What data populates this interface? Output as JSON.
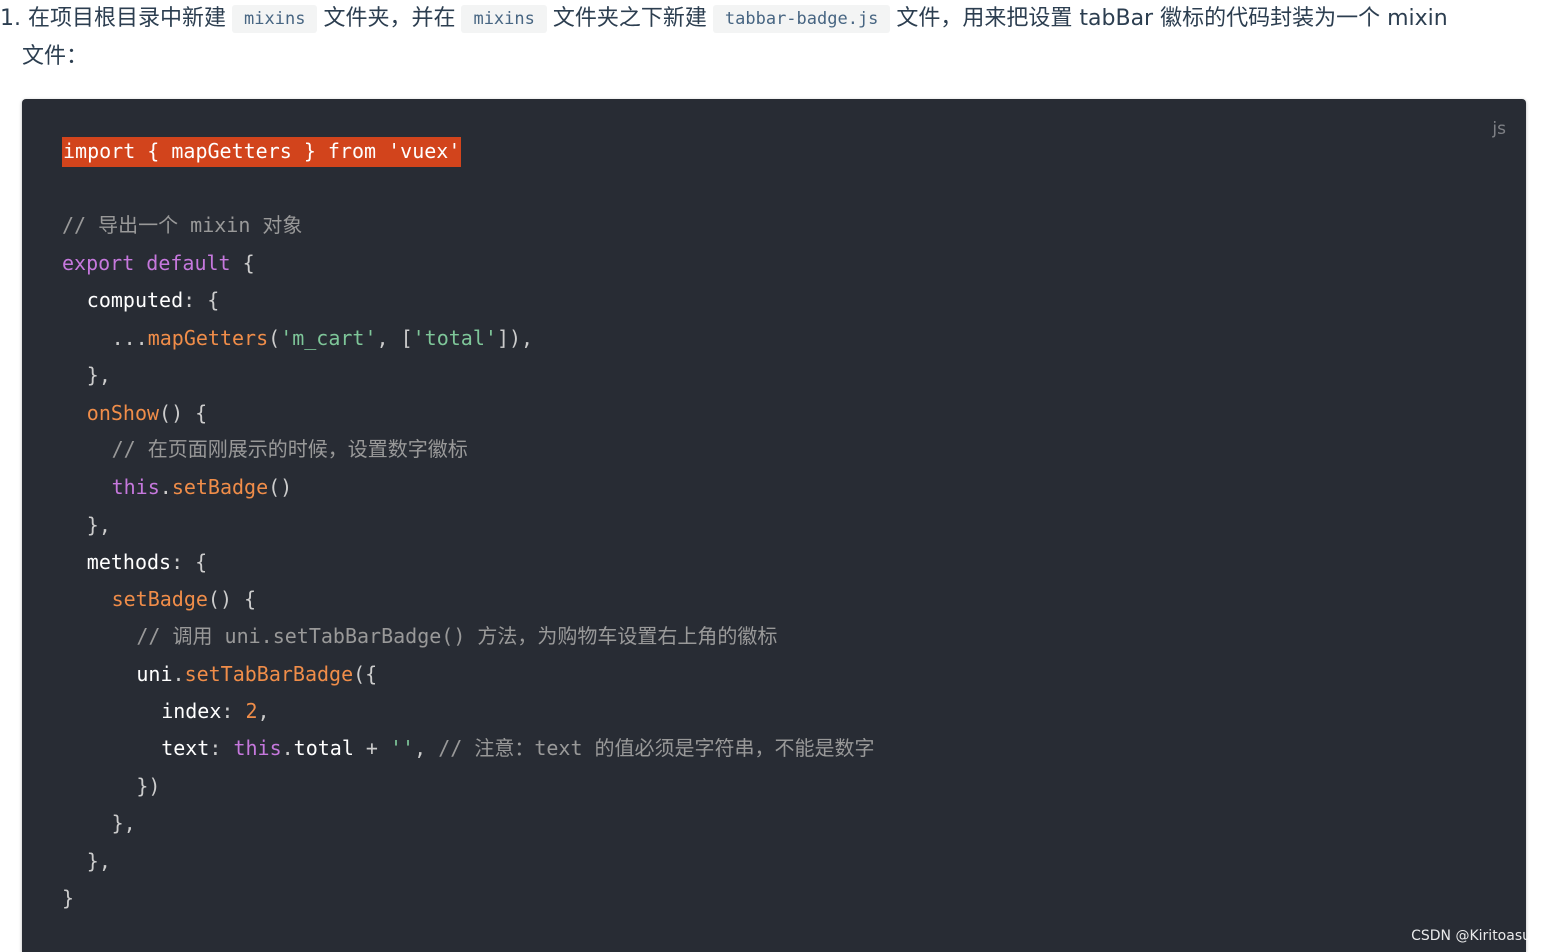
{
  "instruction": {
    "number": "1.",
    "p1": "在项目根目录中新建",
    "code1": "mixins",
    "p2": "文件夹，并在",
    "code2": "mixins",
    "p3": "文件夹之下新建",
    "code3": "tabbar-badge.js",
    "p4": "文件，用来把设置 tabBar 徽标的代码封装为一个 mixin",
    "p5": "文件："
  },
  "code_block": {
    "language": "js",
    "lines": [
      {
        "indent": "",
        "tokens": [
          {
            "t": "import { mapGetters } from 'vuex'",
            "c": "hl"
          }
        ]
      },
      {
        "indent": "",
        "tokens": []
      },
      {
        "indent": "",
        "tokens": [
          {
            "t": "// 导出一个 mixin 对象",
            "c": "cm"
          }
        ]
      },
      {
        "indent": "",
        "tokens": [
          {
            "t": "export",
            "c": "kw"
          },
          {
            "t": " ",
            "c": "white"
          },
          {
            "t": "default",
            "c": "kw"
          },
          {
            "t": " {",
            "c": "pn"
          }
        ]
      },
      {
        "indent": "  ",
        "tokens": [
          {
            "t": "computed",
            "c": "white"
          },
          {
            "t": ": {",
            "c": "pn"
          }
        ]
      },
      {
        "indent": "    ",
        "tokens": [
          {
            "t": "...",
            "c": "pn"
          },
          {
            "t": "mapGetters",
            "c": "fn"
          },
          {
            "t": "(",
            "c": "pn"
          },
          {
            "t": "'m_cart'",
            "c": "str"
          },
          {
            "t": ", [",
            "c": "pn"
          },
          {
            "t": "'total'",
            "c": "str"
          },
          {
            "t": "]),",
            "c": "pn"
          }
        ]
      },
      {
        "indent": "  ",
        "tokens": [
          {
            "t": "},",
            "c": "pn"
          }
        ]
      },
      {
        "indent": "  ",
        "tokens": [
          {
            "t": "onShow",
            "c": "fn"
          },
          {
            "t": "() {",
            "c": "pn"
          }
        ]
      },
      {
        "indent": "    ",
        "tokens": [
          {
            "t": "// 在页面刚展示的时候，设置数字徽标",
            "c": "cm"
          }
        ]
      },
      {
        "indent": "    ",
        "tokens": [
          {
            "t": "this",
            "c": "kw"
          },
          {
            "t": ".",
            "c": "pn"
          },
          {
            "t": "setBadge",
            "c": "fn"
          },
          {
            "t": "()",
            "c": "pn"
          }
        ]
      },
      {
        "indent": "  ",
        "tokens": [
          {
            "t": "},",
            "c": "pn"
          }
        ]
      },
      {
        "indent": "  ",
        "tokens": [
          {
            "t": "methods",
            "c": "white"
          },
          {
            "t": ": {",
            "c": "pn"
          }
        ]
      },
      {
        "indent": "    ",
        "tokens": [
          {
            "t": "setBadge",
            "c": "fn"
          },
          {
            "t": "() {",
            "c": "pn"
          }
        ]
      },
      {
        "indent": "      ",
        "tokens": [
          {
            "t": "// 调用 uni.setTabBarBadge() 方法，为购物车设置右上角的徽标",
            "c": "cm"
          }
        ]
      },
      {
        "indent": "      ",
        "tokens": [
          {
            "t": "uni",
            "c": "white"
          },
          {
            "t": ".",
            "c": "pn"
          },
          {
            "t": "setTabBarBadge",
            "c": "fn"
          },
          {
            "t": "({",
            "c": "pn"
          }
        ]
      },
      {
        "indent": "        ",
        "tokens": [
          {
            "t": "index",
            "c": "white"
          },
          {
            "t": ": ",
            "c": "pn"
          },
          {
            "t": "2",
            "c": "num"
          },
          {
            "t": ",",
            "c": "pn"
          }
        ]
      },
      {
        "indent": "        ",
        "tokens": [
          {
            "t": "text",
            "c": "white"
          },
          {
            "t": ": ",
            "c": "pn"
          },
          {
            "t": "this",
            "c": "kw"
          },
          {
            "t": ".",
            "c": "pn"
          },
          {
            "t": "total",
            "c": "white"
          },
          {
            "t": " + ",
            "c": "pn"
          },
          {
            "t": "''",
            "c": "str"
          },
          {
            "t": ", ",
            "c": "pn"
          },
          {
            "t": "// 注意：text 的值必须是字符串，不能是数字",
            "c": "cm"
          }
        ]
      },
      {
        "indent": "      ",
        "tokens": [
          {
            "t": "})",
            "c": "pn"
          }
        ]
      },
      {
        "indent": "    ",
        "tokens": [
          {
            "t": "},",
            "c": "pn"
          }
        ]
      },
      {
        "indent": "  ",
        "tokens": [
          {
            "t": "},",
            "c": "pn"
          }
        ]
      },
      {
        "indent": "",
        "tokens": [
          {
            "t": "}",
            "c": "pn"
          }
        ]
      }
    ]
  },
  "watermark": "CSDN @Kiritoasu"
}
